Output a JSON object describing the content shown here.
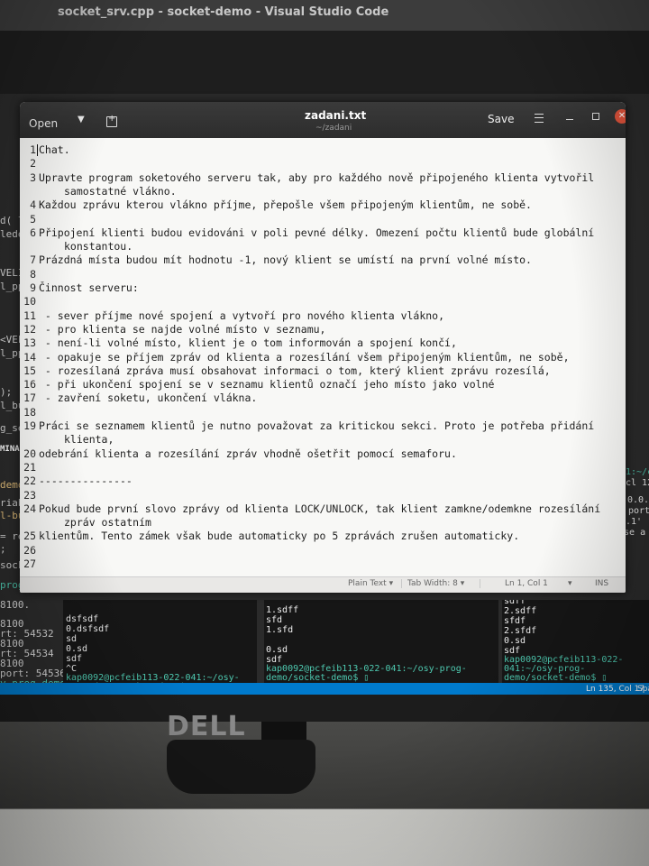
{
  "vscode": {
    "title": "socket_srv.cpp - socket-demo - Visual Studio Code",
    "left_code": [
      "d( l",
      "lede",
      "VELIK",
      "l_ppa",
      "<VELIK",
      "l_ppa",
      ");",
      "l_buf,",
      "g_sem);",
      "MINAL",
      "demo_t",
      "riable",
      "l-but-se",
      "= read(",
      ";",
      "socket_",
      "prog-demo",
      "8100.",
      "8100",
      "rt: 54532",
      "8100",
      "rt: 54534",
      "8100",
      "port: 54536",
      "y-prog-demo"
    ],
    "right_code": [
      "1:~/c",
      "cl 12",
      "0.0.1",
      "port",
      ".1'",
      "ose a"
    ],
    "terminals": [
      {
        "lines": [
          "dsfsdf",
          "0.dsfsdf",
          "sd",
          "0.sd",
          "sdf",
          "^C"
        ],
        "prompt": "kap0092@pcfeib113-022-041:~/osy-prog-demo/socket-demo$ ▯"
      },
      {
        "lines": [
          "1.sdff",
          "sfd",
          "1.sfd",
          "",
          "0.sd",
          "sdf"
        ],
        "prompt": "kap0092@pcfeib113-022-041:~/osy-prog-demo/socket-demo$ ▯"
      },
      {
        "lines": [
          "sdff",
          "2.sdff",
          "sfdf",
          "2.sfdf",
          "0.sd",
          "sdf"
        ],
        "prompt": "kap0092@pcfeib113-022-041:~/osy-prog-demo/socket-demo$ ▯"
      }
    ],
    "status_position": "Ln 135, Col 17",
    "status_extra": "Spa"
  },
  "gedit": {
    "open_label": "Open",
    "title": "zadani.txt",
    "subtitle": "~/zadani",
    "save_label": "Save",
    "lines": [
      {
        "n": "1",
        "t": "Chat."
      },
      {
        "n": "2",
        "t": ""
      },
      {
        "n": "3",
        "t": "Upravte program soketového serveru tak, aby pro každého nově připojeného klienta vytvořil"
      },
      {
        "n": "",
        "t": "samostatné vlákno."
      },
      {
        "n": "4",
        "t": "Každou zprávu kterou vlákno příjme, přepošle všem připojeným klientům, ne sobě."
      },
      {
        "n": "5",
        "t": ""
      },
      {
        "n": "6",
        "t": "Připojení klienti budou evidováni v poli pevné délky. Omezení počtu klientů bude globální"
      },
      {
        "n": "",
        "t": "konstantou."
      },
      {
        "n": "7",
        "t": "Prázdná místa budou mít hodnotu -1, nový klient se umístí na první volné místo."
      },
      {
        "n": "8",
        "t": ""
      },
      {
        "n": "9",
        "t": "Činnost serveru:"
      },
      {
        "n": "10",
        "t": ""
      },
      {
        "n": "11",
        "t": " - sever příjme nové spojení a vytvoří pro nového klienta vlákno,"
      },
      {
        "n": "12",
        "t": "   - pro klienta se najde volné místo v seznamu,"
      },
      {
        "n": "13",
        "t": "   - není-li volné místo, klient je o tom informován a spojení končí,"
      },
      {
        "n": "14",
        "t": "   - opakuje se příjem zpráv od klienta a rozesílání všem připojeným klientům, ne sobě,"
      },
      {
        "n": "15",
        "t": "   - rozesílaná zpráva musí obsahovat informaci o tom, který klient zprávu rozesílá,"
      },
      {
        "n": "16",
        "t": "   - při ukončení spojení se v seznamu klientů označí jeho místo jako volné"
      },
      {
        "n": "17",
        "t": "   - zavření soketu, ukončení vlákna."
      },
      {
        "n": "18",
        "t": ""
      },
      {
        "n": "19",
        "t": "Práci se seznamem klientů je nutno považovat za kritickou sekci. Proto je potřeba přidání"
      },
      {
        "n": "",
        "t": "klienta,"
      },
      {
        "n": "20",
        "t": "odebrání klienta a rozesílání zpráv vhodně ošetřit pomocí semaforu."
      },
      {
        "n": "21",
        "t": ""
      },
      {
        "n": "22",
        "t": "---------------"
      },
      {
        "n": "23",
        "t": ""
      },
      {
        "n": "24",
        "t": "Pokud bude první slovo zprávy od klienta LOCK/UNLOCK, tak klient zamkne/odemkne rozesílání"
      },
      {
        "n": "",
        "t": "zpráv ostatním"
      },
      {
        "n": "25",
        "t": "klientům. Tento zámek však bude automaticky po 5 zprávách zrušen automaticky."
      },
      {
        "n": "26",
        "t": ""
      },
      {
        "n": "27",
        "t": ""
      }
    ],
    "statusbar": {
      "syntax": "Plain Text ▾",
      "tab_width": "Tab Width: 8 ▾",
      "position": "Ln 1, Col 1",
      "position_arrow": "▾",
      "mode": "INS"
    }
  },
  "dell_logo_text": "DELL"
}
